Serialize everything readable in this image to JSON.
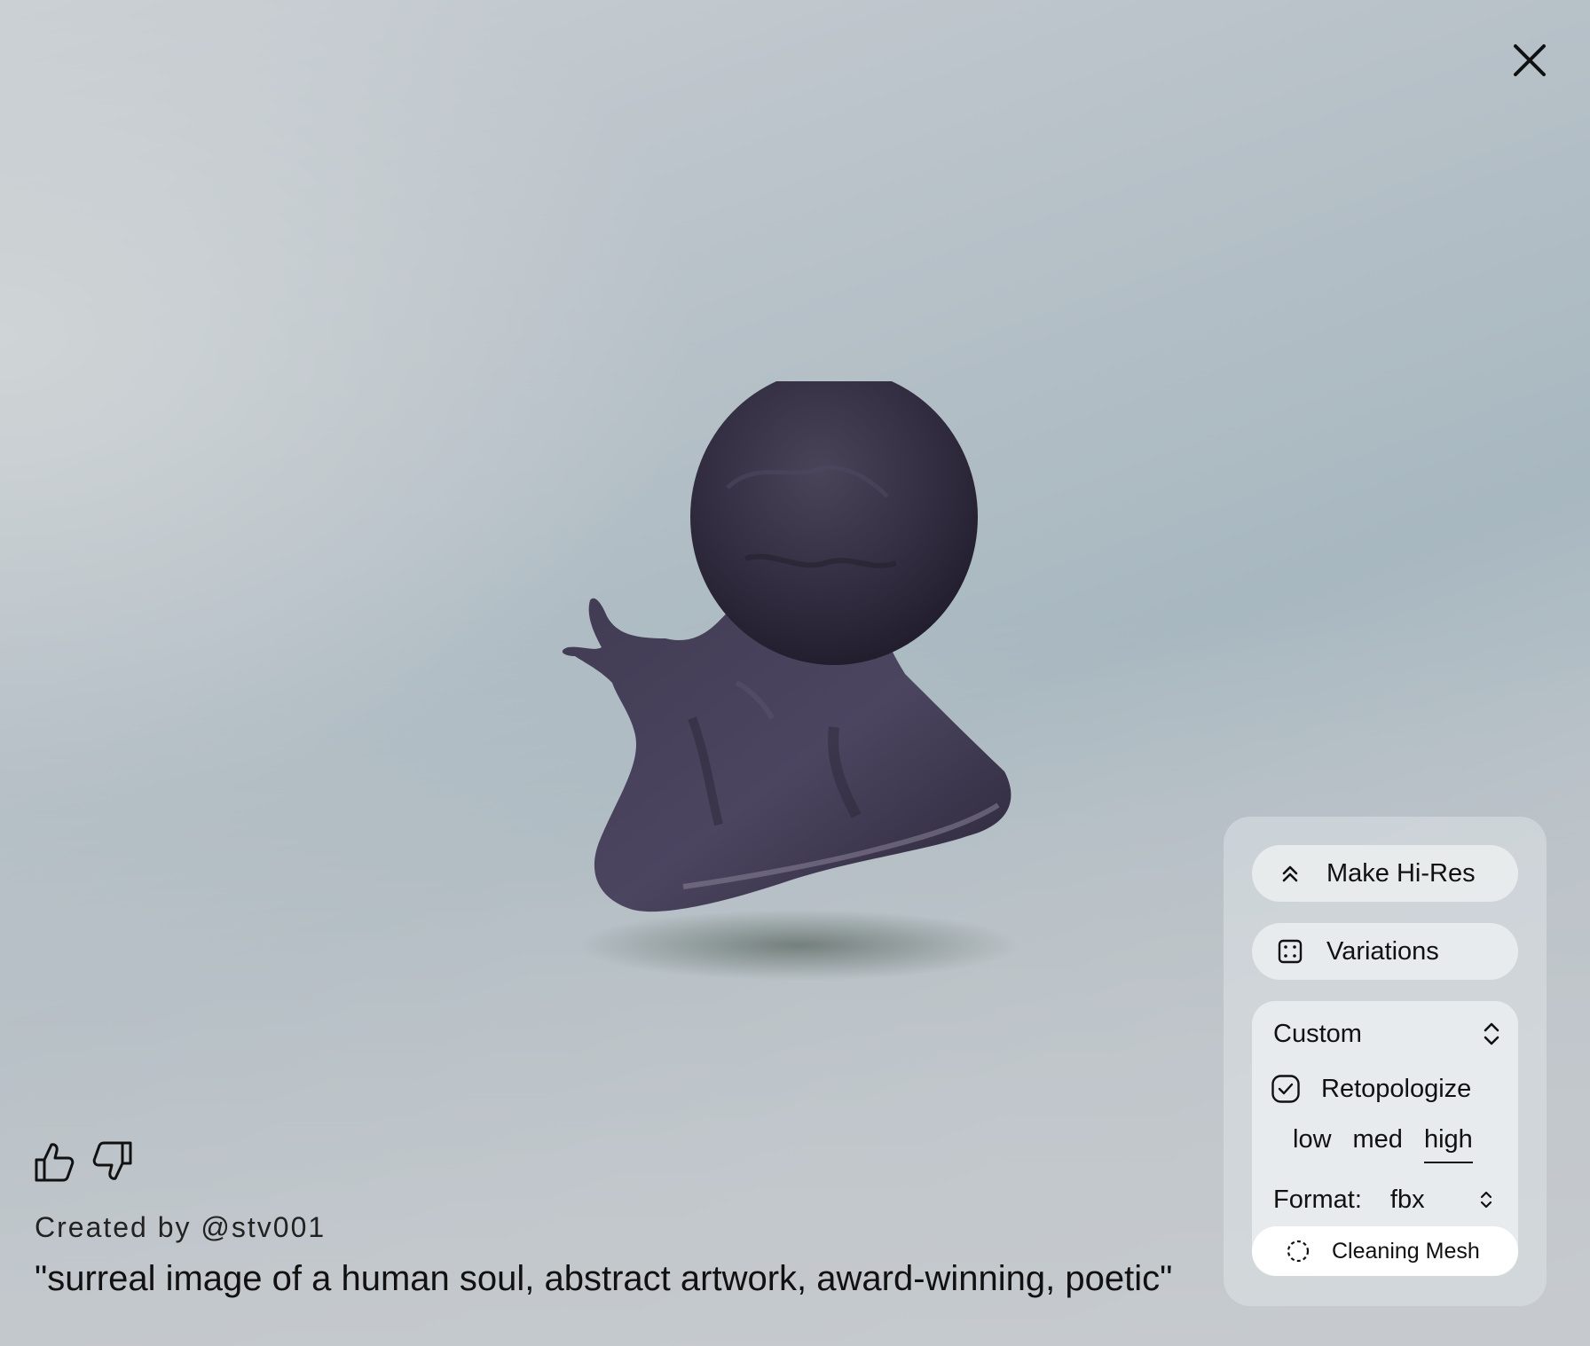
{
  "viewer": {
    "close_icon": "close-icon"
  },
  "feedback": {
    "like_icon": "thumbs-up-icon",
    "dislike_icon": "thumbs-down-icon"
  },
  "creator_text": "Created by @stv001",
  "prompt_text": "\"surreal image of a human soul, abstract artwork, award-winning, poetic\"",
  "panel": {
    "hires_label": "Make Hi-Res",
    "hires_icon": "chevrons-up-icon",
    "variations_label": "Variations",
    "variations_icon": "dice-icon",
    "preset_label": "Custom",
    "preset_icon": "chevron-up-down-icon",
    "retopo_label": "Retopologize",
    "retopo_checked": true,
    "quality_options": [
      "low",
      "med",
      "high"
    ],
    "quality_selected": "high",
    "format_label": "Format:",
    "format_value": "fbx",
    "status_label": "Cleaning Mesh",
    "status_icon": "loading-spinner-icon"
  },
  "colors": {
    "model": "#3a3548",
    "panel_bg": "#dce2e5",
    "status_bg": "#ffffff"
  }
}
